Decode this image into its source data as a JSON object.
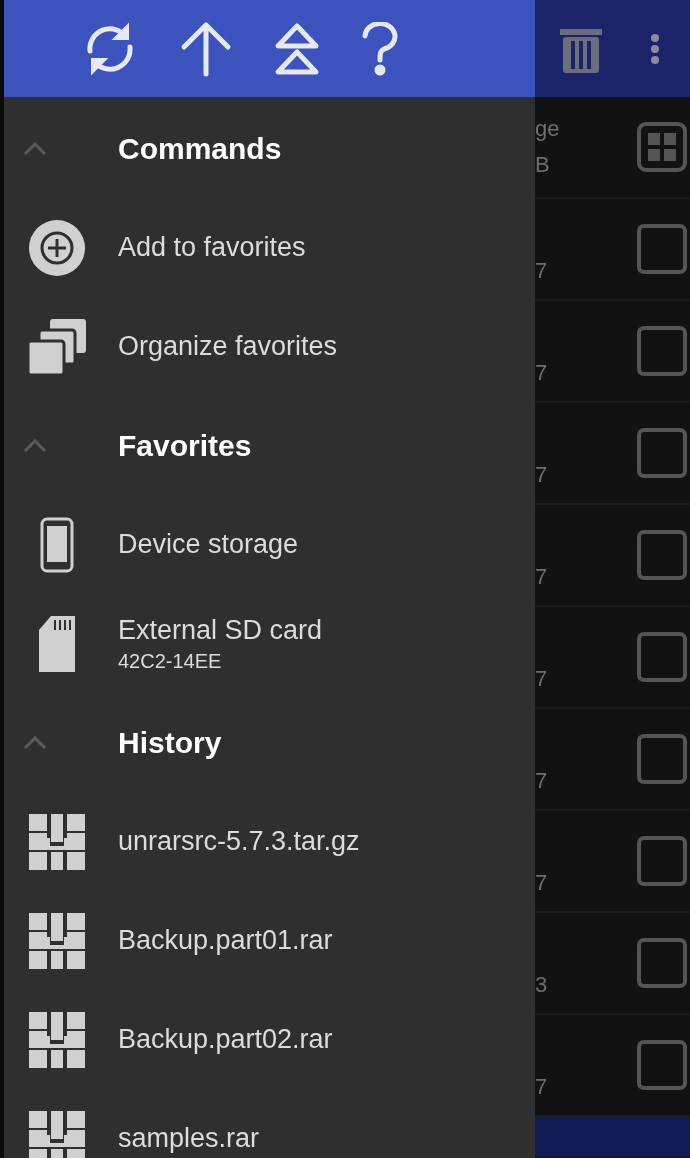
{
  "background": {
    "header_row": {
      "line1": "ge",
      "line2": "B"
    },
    "rows": [
      {
        "text": "7",
        "checked": false
      },
      {
        "text": "7",
        "checked": false
      },
      {
        "text": "7",
        "checked": false
      },
      {
        "text": "7",
        "checked": false
      },
      {
        "text": "7",
        "checked": false
      },
      {
        "text": "7",
        "checked": false
      },
      {
        "text": "7",
        "checked": false
      },
      {
        "text": "3",
        "checked": false
      },
      {
        "text": "7",
        "checked": false
      }
    ]
  },
  "drawer": {
    "sections": [
      {
        "title": "Commands",
        "expanded": true,
        "items": [
          {
            "kind": "add",
            "label": "Add to favorites"
          },
          {
            "kind": "organize",
            "label": "Organize favorites"
          }
        ]
      },
      {
        "title": "Favorites",
        "expanded": true,
        "items": [
          {
            "kind": "phone",
            "label": "Device storage"
          },
          {
            "kind": "sdcard",
            "label": "External SD card",
            "subtitle": "42C2-14EE"
          }
        ]
      },
      {
        "title": "History",
        "expanded": true,
        "items": [
          {
            "kind": "archive",
            "label": "unrarsrc-5.7.3.tar.gz"
          },
          {
            "kind": "archive",
            "label": "Backup.part01.rar"
          },
          {
            "kind": "archive",
            "label": "Backup.part02.rar"
          },
          {
            "kind": "archive",
            "label": "samples.rar"
          }
        ]
      }
    ]
  }
}
